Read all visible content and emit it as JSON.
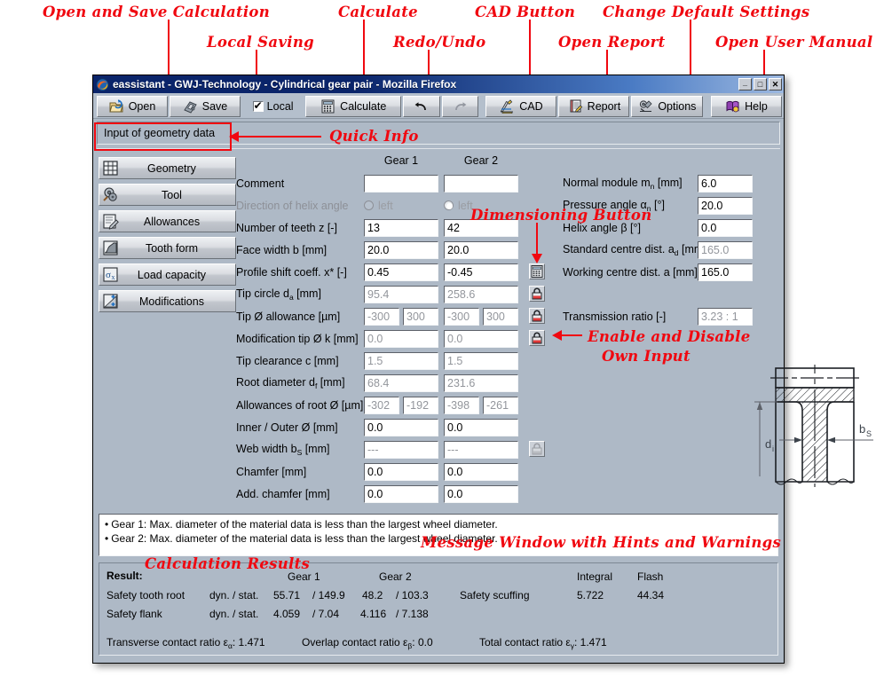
{
  "annotations": [
    {
      "id": "a1",
      "text": "Open and Save Calculation"
    },
    {
      "id": "a2",
      "text": "Local Saving"
    },
    {
      "id": "a3",
      "text": "Calculate"
    },
    {
      "id": "a4",
      "text": "Redo/Undo"
    },
    {
      "id": "a5",
      "text": "CAD Button"
    },
    {
      "id": "a6",
      "text": "Open Report"
    },
    {
      "id": "a7",
      "text": "Change Default Settings"
    },
    {
      "id": "a8",
      "text": "Open User Manual"
    },
    {
      "id": "a9",
      "text": "Quick Info"
    },
    {
      "id": "a10",
      "text": "Dimensioning Button"
    },
    {
      "id": "a11a",
      "text": "Enable and Disable"
    },
    {
      "id": "a11b",
      "text": "Own Input"
    },
    {
      "id": "a12",
      "text": "Message Window with Hints and Warnings"
    },
    {
      "id": "a13",
      "text": "Calculation Results"
    }
  ],
  "window": {
    "title": "eassistant - GWJ-Technology - Cylindrical gear pair - Mozilla Firefox",
    "minimize": "_",
    "maximize": "□",
    "close": "✕"
  },
  "toolbar": {
    "open": "Open",
    "save": "Save",
    "local": "Local",
    "calculate": "Calculate",
    "undo": "↰",
    "redo": "↱",
    "cad": "CAD",
    "report": "Report",
    "options": "Options",
    "help": "Help"
  },
  "quick_info": "Input of geometry data",
  "sidebar": {
    "items": [
      {
        "label": "Geometry"
      },
      {
        "label": "Tool"
      },
      {
        "label": "Allowances"
      },
      {
        "label": "Tooth form"
      },
      {
        "label": "Load capacity"
      },
      {
        "label": "Modifications"
      }
    ]
  },
  "form": {
    "col1": "Gear 1",
    "col2": "Gear 2",
    "rows": [
      {
        "label": "Comment",
        "v1": "",
        "v2": "",
        "ro": false,
        "type": "text"
      },
      {
        "label": "Direction of helix angle",
        "v1": "left",
        "v2": "left",
        "ro": true,
        "type": "radio",
        "sel1": false,
        "sel2": true
      },
      {
        "label": "Number of teeth z [-]",
        "v1": "13",
        "v2": "42",
        "ro": false,
        "type": "text"
      },
      {
        "label": "Face width b [mm]",
        "v1": "20.0",
        "v2": "20.0",
        "ro": false,
        "type": "text"
      },
      {
        "label": "Profile shift coeff. x* [-]",
        "v1": "0.45",
        "v2": "-0.45",
        "ro": false,
        "type": "text"
      },
      {
        "label": "Tip circle d_a [mm]",
        "v1": "95.4",
        "v2": "258.6",
        "ro": true,
        "type": "text"
      },
      {
        "label": "Tip Ø allowance [µm]",
        "v1": "-300",
        "v1b": "300",
        "v2": "-300",
        "v2b": "300",
        "ro": true,
        "type": "pair"
      },
      {
        "label": "Modification tip Ø k [mm]",
        "v1": "0.0",
        "v2": "0.0",
        "ro": true,
        "type": "text"
      },
      {
        "label": "Tip clearance c [mm]",
        "v1": "1.5",
        "v2": "1.5",
        "ro": true,
        "type": "text"
      },
      {
        "label": "Root diameter d_f [mm]",
        "v1": "68.4",
        "v2": "231.6",
        "ro": true,
        "type": "text"
      },
      {
        "label": "Allowances of root Ø [µm]",
        "v1": "-302",
        "v1b": "-192",
        "v2": "-398",
        "v2b": "-261",
        "ro": true,
        "type": "pair"
      },
      {
        "label": "Inner / Outer Ø [mm]",
        "v1": "0.0",
        "v2": "0.0",
        "ro": false,
        "type": "text"
      },
      {
        "label": "Web width b_S [mm]",
        "v1": "---",
        "v2": "---",
        "ro": true,
        "type": "text"
      },
      {
        "label": "Chamfer [mm]",
        "v1": "0.0",
        "v2": "0.0",
        "ro": false,
        "type": "text"
      },
      {
        "label": "Add. chamfer [mm]",
        "v1": "0.0",
        "v2": "0.0",
        "ro": false,
        "type": "text"
      }
    ]
  },
  "right_panel": {
    "normal_module_label": "Normal module m",
    "normal_module_sub": "n",
    "normal_module_unit": " [mm]",
    "normal_module_value": "6.0",
    "pressure_angle_label": "Pressure angle α",
    "pressure_angle_sub": "n",
    "pressure_angle_unit": " [°]",
    "pressure_angle_value": "20.0",
    "helix_angle_label": "Helix angle β [°]",
    "helix_angle_value": "0.0",
    "std_centre_label": "Standard centre dist. a",
    "std_centre_sub": "d",
    "std_centre_unit": " [mm]",
    "std_centre_value": "165.0",
    "work_centre_label": "Working centre dist. a [mm]",
    "work_centre_value": "165.0",
    "ratio_label": "Transmission ratio [-]",
    "ratio_value": "3.23 : 1"
  },
  "drawing": {
    "dim_inner": "d",
    "dim_inner_sub": "i",
    "dim_web": "b",
    "dim_web_sub": "S"
  },
  "messages": [
    "Gear 1: Max. diameter of the material data is less than the largest wheel diameter.",
    "Gear 2: Max. diameter of the material data is less than the largest wheel diameter."
  ],
  "results": {
    "result_label": "Result:",
    "head_gear1": "Gear 1",
    "head_gear2": "Gear 2",
    "head_integral": "Integral",
    "head_flash": "Flash",
    "row1_label": "Safety tooth root",
    "row1_mode": "dyn. / stat.",
    "row1_g1a": "55.71",
    "row1_g1b": "/ 149.9",
    "row1_g2a": "48.2",
    "row1_g2b": "/ 103.3",
    "scuffing_label": "Safety scuffing",
    "scuffing_integral": "5.722",
    "scuffing_flash": "44.34",
    "row2_label": "Safety flank",
    "row2_mode": "dyn. / stat.",
    "row2_g1a": "4.059",
    "row2_g1b": "/ 7.04",
    "row2_g2a": "4.116",
    "row2_g2b": "/ 7.138",
    "transverse_label": "Transverse contact ratio ε",
    "transverse_sub": "α",
    "transverse_value": ": 1.471",
    "overlap_label": "Overlap contact ratio ε",
    "overlap_sub": "β",
    "overlap_value": ": 0.0",
    "total_label": "Total contact ratio ε",
    "total_sub": "γ",
    "total_value": ": 1.471"
  },
  "colors": {
    "window_bg": "#aeb9c6",
    "annotation": "#f00810",
    "titlebar": "#0a246a"
  }
}
